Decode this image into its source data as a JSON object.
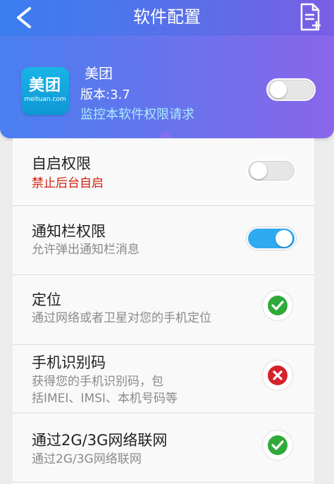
{
  "header": {
    "title": "软件配置",
    "back_icon": "chevron-left-icon",
    "doc_icon": "document-add-icon"
  },
  "app": {
    "icon_text": "美团",
    "icon_subtext": "meituan.com",
    "name": "美团",
    "version": "版本:3.7",
    "monitor_label": "监控本软件权限请求",
    "monitor_enabled": false
  },
  "permissions": [
    {
      "title": "自启权限",
      "desc": "禁止后台自启",
      "desc_color": "#d21e0e",
      "control": "toggle",
      "enabled": false
    },
    {
      "title": "通知栏权限",
      "desc": "允许弹出通知栏消息",
      "control": "toggle",
      "enabled": true
    },
    {
      "title": "定位",
      "desc": "通过网络或者卫星对您的手机定位",
      "control": "status",
      "allowed": true,
      "icon": "check-circle-icon"
    },
    {
      "title": "手机识别码",
      "desc_line1": "获得您的手机识别码，包",
      "desc_line2": "括IMEI、IMSI、本机号码等",
      "control": "status",
      "allowed": false,
      "icon": "x-circle-icon"
    },
    {
      "title": "通过2G/3G网络联网",
      "desc": "通过2G/3G网络联网",
      "control": "status",
      "allowed": true,
      "icon": "check-circle-icon"
    }
  ],
  "colors": {
    "accent_blue": "#2eaaf0",
    "allowed_green": "#2faa3a",
    "denied_red": "#d4232a"
  }
}
